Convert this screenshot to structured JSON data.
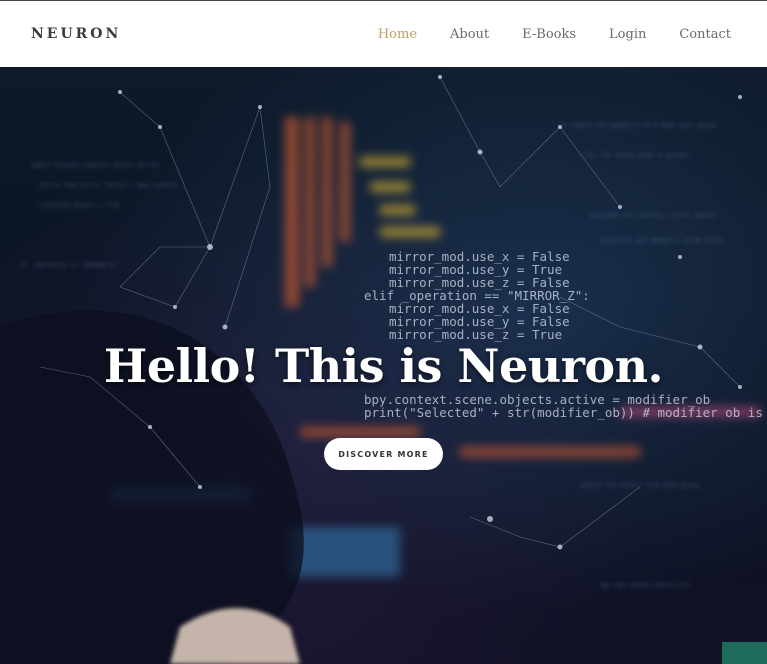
{
  "brand": "NEURON",
  "nav": {
    "items": [
      {
        "label": "Home",
        "active": true
      },
      {
        "label": "About",
        "active": false
      },
      {
        "label": "E-Books",
        "active": false
      },
      {
        "label": "Login",
        "active": false
      },
      {
        "label": "Contact",
        "active": false
      }
    ]
  },
  "hero": {
    "title": "Hello! This is Neuron.",
    "cta_label": "DISCOVER MORE",
    "code_lines": [
      "mirror_mod.use_x = False",
      "mirror_mod.use_y = True",
      "mirror_mod.use_z = False",
      "elif _operation == \"MIRROR_Z\":",
      "mirror_mod.use_x = False",
      "mirror_mod.use_y = False",
      "mirror_mod.use_z = True",
      "bpy.context.scene.objects.active = modifier_ob",
      "print(\"Selected\" + str(modifier_ob)) # modifier ob is the active ob"
    ]
  },
  "colors": {
    "accent": "#b9a36a",
    "nav_text": "#6a6a6a",
    "brand_text": "#3a3a3a",
    "hero_bg": "#0a1322",
    "code_text": "#cfd6e6",
    "code_orange": "#e0643a"
  }
}
